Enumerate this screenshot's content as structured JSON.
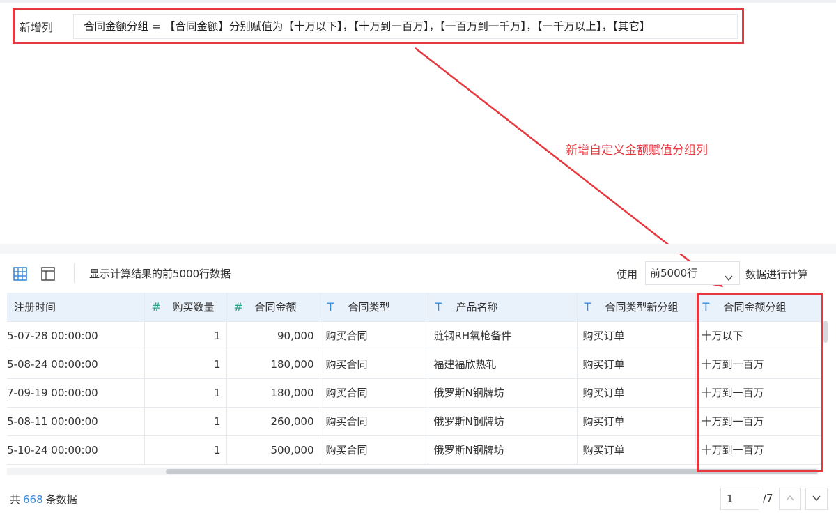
{
  "formula_bar": {
    "label": "新增列",
    "expression": "合同金额分组 = 【合同金额】分别赋值为【十万以下】，【十万到一百万】，【一百万到一千万】，【一千万以上】，【其它】"
  },
  "annotation": {
    "text": "新增自定义金额赋值分组列"
  },
  "toolbar": {
    "grid_icon": "grid-icon",
    "layout_icon": "layout-icon",
    "preview_text": "显示计算结果的前5000行数据",
    "use_label": "使用",
    "rows_value": "前5000行",
    "calc_label": "数据进行计算"
  },
  "table": {
    "columns": [
      {
        "type": "",
        "label": "注册时间"
      },
      {
        "type": "#",
        "label": "购买数量"
      },
      {
        "type": "#",
        "label": "合同金额"
      },
      {
        "type": "T",
        "label": "合同类型"
      },
      {
        "type": "T",
        "label": "产品名称"
      },
      {
        "type": "T",
        "label": "合同类型新分组"
      },
      {
        "type": "T",
        "label": "合同金额分组"
      }
    ],
    "rows": [
      [
        "5-07-28 00:00:00",
        "1",
        "90,000",
        "购买合同",
        "涟钢RH氧枪备件",
        "购买订单",
        "十万以下"
      ],
      [
        "5-08-24 00:00:00",
        "1",
        "180,000",
        "购买合同",
        "福建福欣热轧",
        "购买订单",
        "十万到一百万"
      ],
      [
        "7-09-19 00:00:00",
        "1",
        "180,000",
        "购买合同",
        "俄罗斯N钢牌坊",
        "购买订单",
        "十万到一百万"
      ],
      [
        "5-08-11 00:00:00",
        "1",
        "260,000",
        "购买合同",
        "俄罗斯N钢牌坊",
        "购买订单",
        "十万到一百万"
      ],
      [
        "5-10-24 00:00:00",
        "1",
        "500,000",
        "购买合同",
        "俄罗斯N钢牌坊",
        "购买订单",
        "十万到一百万"
      ]
    ]
  },
  "footer": {
    "count_prefix": "共",
    "count_value": "668",
    "count_suffix": "条数据",
    "page_current": "1",
    "page_total": "/7"
  },
  "colors": {
    "annotation_red": "#e5393f",
    "accent_blue": "#3b8ad9",
    "hash_green": "#27a58a",
    "header_bg": "#e9f1fb"
  }
}
